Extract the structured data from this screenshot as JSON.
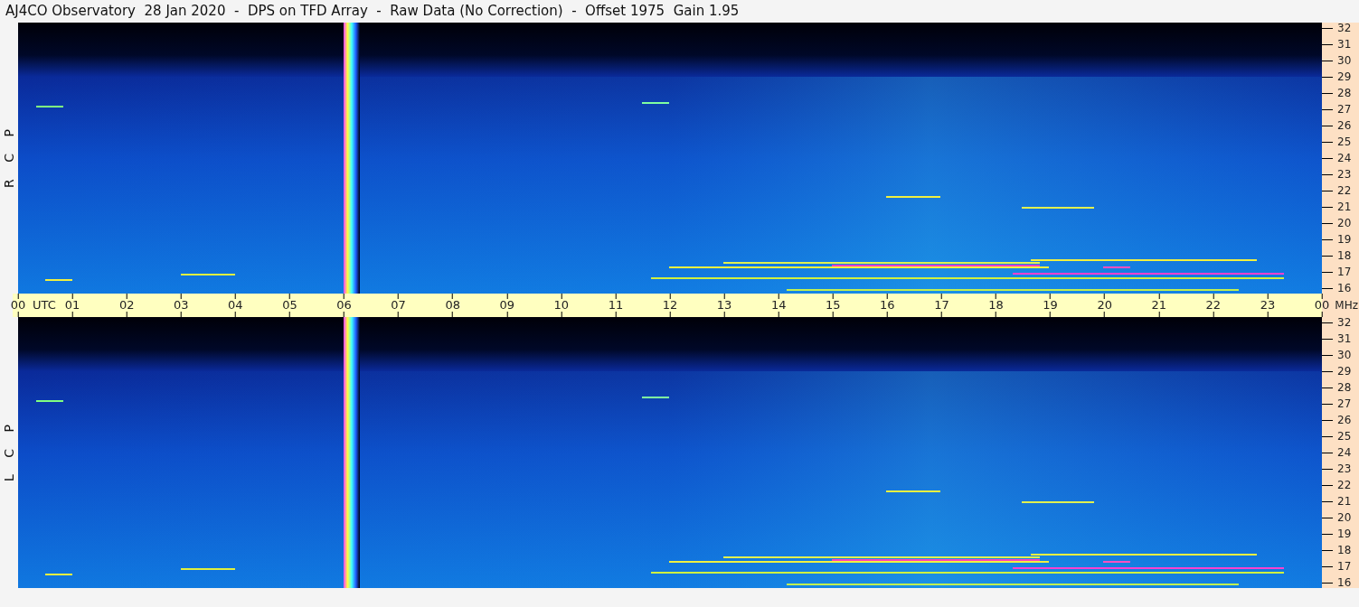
{
  "title": "AJ4CO Observatory  28 Jan 2020  -  DPS on TFD Array  -  Raw Data (No Correction)  -  Offset 1975  Gain 1.95",
  "panels": [
    {
      "label": "R C P",
      "frequency_ticks": [
        "32",
        "31",
        "30",
        "29",
        "28",
        "27",
        "26",
        "25",
        "24",
        "23",
        "22",
        "21",
        "20",
        "19",
        "18",
        "17",
        "16"
      ]
    },
    {
      "label": "L C P",
      "frequency_ticks": [
        "32",
        "31",
        "30",
        "29",
        "28",
        "27",
        "26",
        "25",
        "24",
        "23",
        "22",
        "21",
        "20",
        "19",
        "18",
        "17",
        "16"
      ]
    }
  ],
  "time_axis": {
    "unit": "UTC",
    "frequency_unit": "MHz",
    "ticks": [
      "00",
      "01",
      "02",
      "03",
      "04",
      "05",
      "06",
      "07",
      "08",
      "09",
      "10",
      "11",
      "12",
      "13",
      "14",
      "15",
      "16",
      "17",
      "18",
      "19",
      "20",
      "21",
      "22",
      "23",
      "00"
    ]
  }
}
